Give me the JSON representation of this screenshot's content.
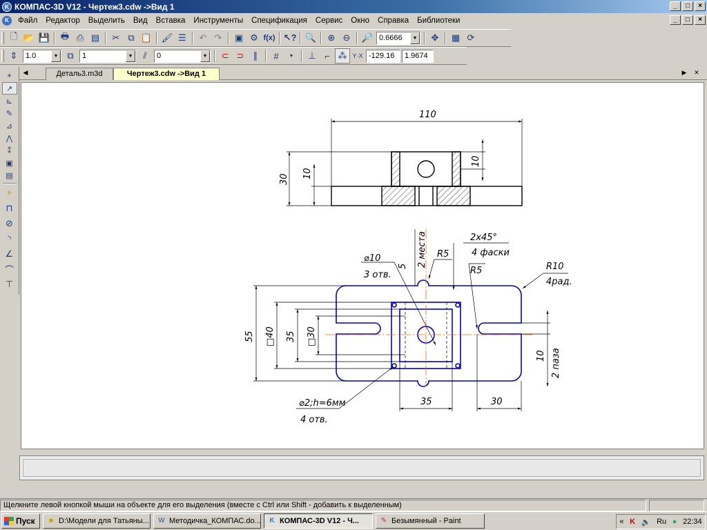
{
  "window": {
    "title": "КОМПАС-3D V12 - Чертеж3.cdw ->Вид 1",
    "minimize": "_",
    "maximize": "□",
    "close": "×"
  },
  "menu": {
    "items": [
      "Файл",
      "Редактор",
      "Выделить",
      "Вид",
      "Вставка",
      "Инструменты",
      "Спецификация",
      "Сервис",
      "Окно",
      "Справка",
      "Библиотеки"
    ]
  },
  "toolbar_standard": {
    "zoom_value": "0.6666"
  },
  "toolbar_current_state": {
    "step_value": "1.0",
    "layer_value": "1",
    "style_value": "0",
    "coord_x": "-129.16",
    "coord_y": "1.9674"
  },
  "tabs": [
    {
      "label": "Деталь3.m3d",
      "active": false
    },
    {
      "label": "Чертеж3.cdw ->Вид 1",
      "active": true
    }
  ],
  "drawing": {
    "top_view": {
      "dim_width": "110",
      "dim_height": "30",
      "dim_base": "10",
      "dim_hole": "10"
    },
    "plan_view": {
      "hole_label": "⌀10",
      "hole_count": "3 отв.",
      "dim_5": "5",
      "places": "2 места",
      "r5_top": "R5",
      "chamfer": "2x45°",
      "chamfer_count": "4 фаски",
      "r5_right": "R5",
      "r10": "R10",
      "r10_count": "4рад.",
      "dim_55": "55",
      "dim_sq40": "□40",
      "dim_35_left": "35",
      "dim_sq30": "□30",
      "dim_10_slot": "10",
      "slot_count": "2 паза",
      "dim_35_bottom": "35",
      "dim_30_bottom": "30",
      "small_hole": "⌀2;h=6мм",
      "small_hole_count": "4 отв."
    },
    "colors": {
      "outline": "#0000cc",
      "axis": "#ff6600",
      "dim": "#000000"
    }
  },
  "status": {
    "hint": "Щелкните левой кнопкой мыши на объекте для его выделения (вместе с Ctrl или Shift - добавить к выделенным)"
  },
  "taskbar": {
    "start": "Пуск",
    "tasks": [
      {
        "label": "D:\\Модели для Татьяны...",
        "icon": "folder-icon",
        "active": false
      },
      {
        "label": "Методичка_КОМПАС.do...",
        "icon": "word-icon",
        "active": false
      },
      {
        "label": "КОМПАС-3D V12 - Ч...",
        "icon": "kompas-icon",
        "active": true
      },
      {
        "label": "Безымянный - Paint",
        "icon": "paint-icon",
        "active": false
      }
    ],
    "tray": {
      "chevron": "«",
      "lang": "Ru",
      "time": "22:34"
    }
  }
}
